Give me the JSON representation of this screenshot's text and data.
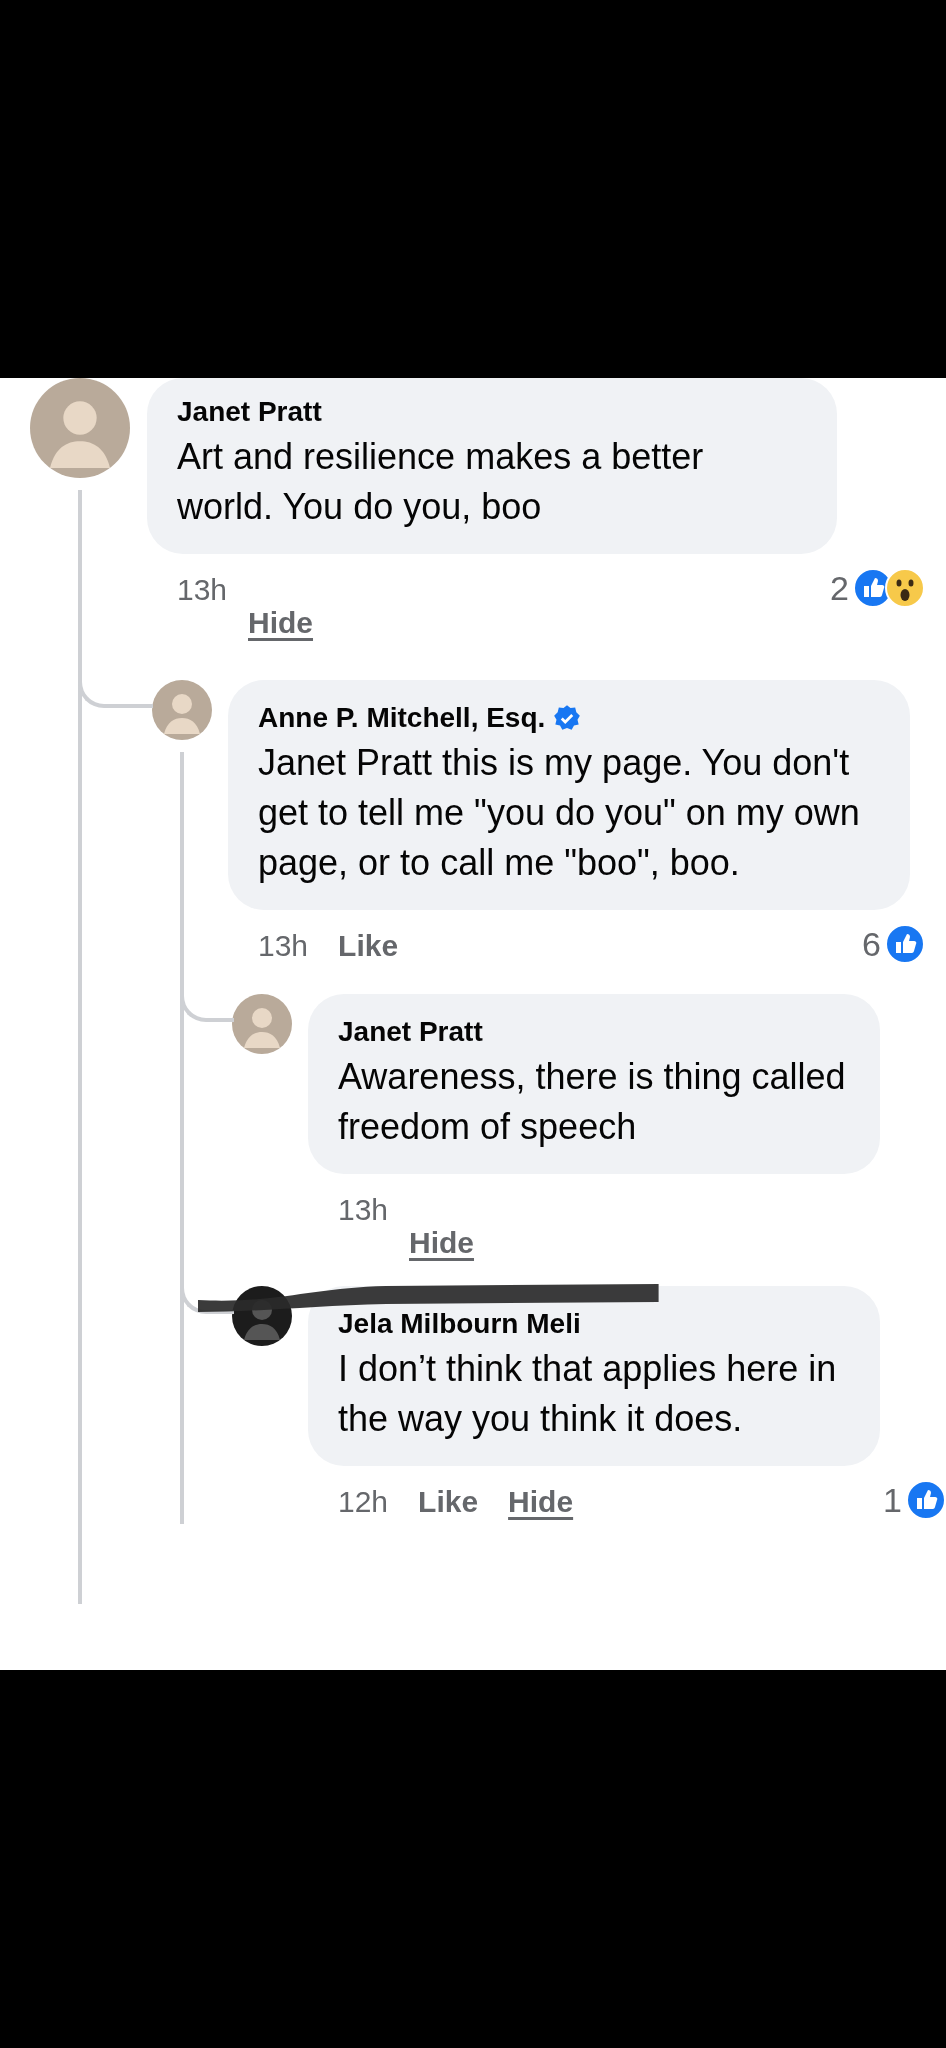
{
  "comments": [
    {
      "author": "Janet Pratt",
      "text": "Art and resilience makes a better world.  You do you, boo",
      "time": "13h",
      "actions": [
        {
          "label": "Hide",
          "kind": "hide"
        }
      ],
      "reactions": {
        "count": "2",
        "types": [
          {
            "kind": "like"
          },
          {
            "kind": "wow"
          }
        ]
      },
      "children": [
        {
          "author": "Anne P. Mitchell, Esq.",
          "verified": true,
          "text": "Janet Pratt this is my page. You don't get to tell me \"you do you\" on my own page, or to call me \"boo\", boo.",
          "time": "13h",
          "actions": [
            {
              "label": "Like",
              "kind": "like"
            }
          ],
          "reactions": {
            "count": "6",
            "types": [
              {
                "kind": "like"
              }
            ]
          },
          "children": [
            {
              "author": "Janet Pratt",
              "text": "Awareness, there is thing called freedom of speech",
              "time": "13h",
              "actions": [
                {
                  "label": "Hide",
                  "kind": "hide"
                }
              ]
            },
            {
              "author": "Jela Milbourn Meli",
              "redacted": true,
              "text": "I don’t think that applies here in the way you think it does.",
              "time": "12h",
              "actions": [
                {
                  "label": "Like",
                  "kind": "like"
                },
                {
                  "label": "Hide",
                  "kind": "hide"
                }
              ],
              "reactions": {
                "count": "1",
                "types": [
                  {
                    "kind": "like"
                  }
                ]
              }
            }
          ]
        }
      ]
    }
  ]
}
